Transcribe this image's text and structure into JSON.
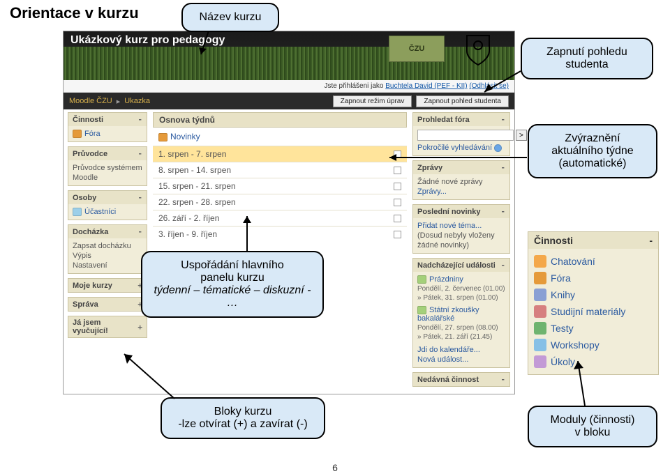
{
  "page_heading": "Orientace v kurzu",
  "page_number": "6",
  "screen": {
    "banner_title": "Ukázkový kurz pro pedagogy",
    "logo_text": "ČZU",
    "login": {
      "prefix": "Jste přihlášeni jako ",
      "user": "Buchtela David (PEF - KII)",
      "logout": "(Odhlásit se)"
    },
    "crumb1": "Moodle ČZU",
    "crumb2": "Ukazka",
    "btn_edit": "Zapnout režim úprav",
    "btn_student": "Zapnout pohled studenta"
  },
  "left": {
    "cinnosti": {
      "title": "Činnosti",
      "item_fora": "Fóra"
    },
    "pruvodce": {
      "title": "Průvodce",
      "line1": "Průvodce systémem",
      "line2": "Moodle"
    },
    "osoby": {
      "title": "Osoby",
      "item": "Účastníci"
    },
    "dochazka": {
      "title": "Docházka",
      "l1": "Zapsat docházku",
      "l2": "Výpis",
      "l3": "Nastavení"
    },
    "mojekurzy": {
      "title": "Moje kurzy"
    },
    "sprava": {
      "title": "Správa"
    },
    "jajsem": {
      "title": "Já jsem vyučující!"
    }
  },
  "mid": {
    "title": "Osnova týdnů",
    "novinky": "Novinky",
    "weeks": [
      "1. srpen - 7. srpen",
      "8. srpen - 14. srpen",
      "15. srpen - 21. srpen",
      "22. srpen - 28. srpen",
      "26. září - 2. říjen",
      "3. říjen - 9. říjen"
    ]
  },
  "right": {
    "fora": {
      "title": "Prohledat fóra",
      "btn": ">",
      "adv": "Pokročilé vyhledávání"
    },
    "zpravy": {
      "title": "Zprávy",
      "l1": "Žádné nové zprávy",
      "l2": "Zprávy..."
    },
    "novinky": {
      "title": "Poslední novinky",
      "l1": "Přidat nové téma...",
      "l2": "(Dosud nebyly vloženy",
      "l3": "žádné novinky)"
    },
    "udalosti": {
      "title": "Nadcházející události",
      "r1": "Prázdniny",
      "r1a": "Pondělí, 2. červenec (01.00)",
      "r1b": "» Pátek, 31. srpen (01.00)",
      "r2": "Státní zkoušky bakalářské",
      "r2a": "Pondělí, 27. srpen (08.00)",
      "r2b": "» Pátek, 21. září (21.45)",
      "cal": "Jdi do kalendáře...",
      "newev": "Nová událost..."
    },
    "nedavna": {
      "title": "Nedávná činnost"
    }
  },
  "bigblock": {
    "title": "Činnosti",
    "items": [
      {
        "label": "Chatování",
        "color": "#f4a84a"
      },
      {
        "label": "Fóra",
        "color": "#e59a3a"
      },
      {
        "label": "Knihy",
        "color": "#8aa0d4"
      },
      {
        "label": "Studijní materiály",
        "color": "#d67f7f"
      },
      {
        "label": "Testy",
        "color": "#6fb46f"
      },
      {
        "label": "Workshopy",
        "color": "#86c0e6"
      },
      {
        "label": "Úkoly",
        "color": "#c39ad6"
      }
    ]
  },
  "callouts": {
    "nazev": "Název kurzu",
    "zapnuti_l1": "Zapnutí pohledu",
    "zapnuti_l2": "studenta",
    "zvyraz_l1": "Zvýraznění",
    "zvyraz_l2": "aktuálního týdne",
    "zvyraz_l3": "(automatické)",
    "usporad_l1": "Uspořádání hlavního",
    "usporad_l2": "panelu kurzu",
    "usporad_em": "týdenní – tématické – diskuzní - …",
    "bloky_l1": "Bloky kurzu",
    "bloky_l2": "-lze otvírat (+) a zavírat (-)",
    "moduly_l1": "Moduly (činnosti)",
    "moduly_l2": "v bloku"
  }
}
